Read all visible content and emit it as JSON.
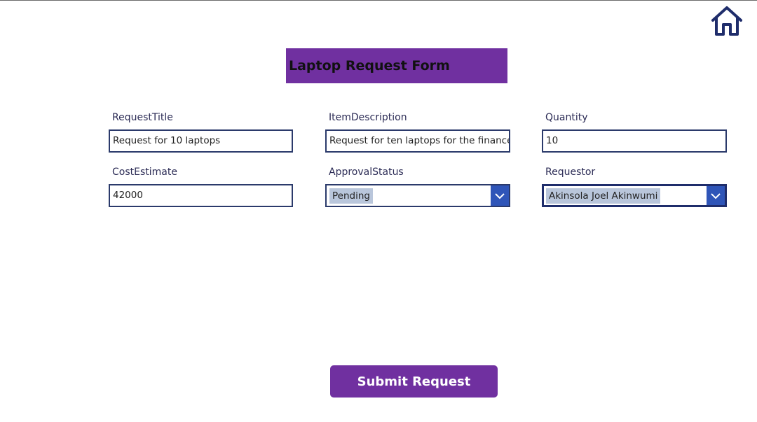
{
  "header": {
    "title": "Laptop Request Form",
    "home_icon": "home-icon"
  },
  "fields": {
    "request_title": {
      "label": "RequestTitle",
      "value": "Request for 10 laptops"
    },
    "item_description": {
      "label": "ItemDescription",
      "value": "Request for ten laptops for the finance t"
    },
    "quantity": {
      "label": "Quantity",
      "value": "10"
    },
    "cost_estimate": {
      "label": "CostEstimate",
      "value": "42000"
    },
    "approval_status": {
      "label": "ApprovalStatus",
      "value": "Pending"
    },
    "requestor": {
      "label": "Requestor",
      "value": "Akinsola Joel Akinwumi"
    }
  },
  "actions": {
    "submit_label": "Submit Request"
  },
  "colors": {
    "accent": "#7030a0",
    "input_border": "#2b3a6b",
    "dropdown_chevron_bg": "#2f55b8",
    "selection_highlight": "#b9c6db",
    "home_icon": "#1f2d6b"
  }
}
